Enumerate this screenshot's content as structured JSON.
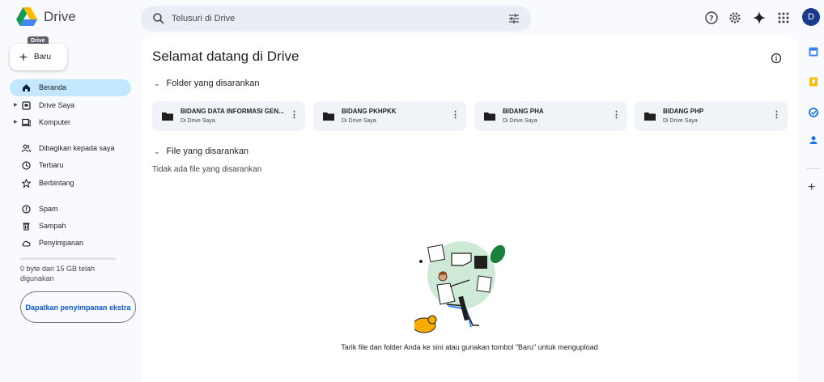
{
  "app": {
    "name": "Drive"
  },
  "header": {
    "search_placeholder": "Telusuri di Drive",
    "avatar_initial": "D",
    "icons": [
      "help-icon",
      "settings-icon",
      "gemini-icon",
      "apps-grid-icon"
    ]
  },
  "sidebar": {
    "tooltip": "Drive",
    "new_label": "Baru",
    "items": [
      {
        "label": "Beranda",
        "icon": "home-icon",
        "active": true
      },
      {
        "label": "Drive Saya",
        "icon": "my-drive-icon",
        "expandable": true
      },
      {
        "label": "Komputer",
        "icon": "computer-icon",
        "expandable": true
      },
      {
        "label": "Dibagikan kepada saya",
        "icon": "shared-icon"
      },
      {
        "label": "Terbaru",
        "icon": "recent-icon"
      },
      {
        "label": "Berbintang",
        "icon": "star-icon"
      },
      {
        "label": "Spam",
        "icon": "spam-icon"
      },
      {
        "label": "Sampah",
        "icon": "trash-icon"
      },
      {
        "label": "Penyimpanan",
        "icon": "cloud-icon"
      }
    ],
    "storage_text": "0 byte dari 15 GB telah digunakan",
    "storage_used_fraction": 0,
    "get_storage_label": "Dapatkan penyimpanan ekstra"
  },
  "main": {
    "welcome": "Selamat datang di Drive",
    "suggested_folders_title": "Folder yang disarankan",
    "folders": [
      {
        "name": "BIDANG DATA INFORMASI GEN...",
        "location": "Di Drive Saya"
      },
      {
        "name": "BIDANG PKHPKK",
        "location": "Di Drive Saya"
      },
      {
        "name": "BIDANG PHA",
        "location": "Di Drive Saya"
      },
      {
        "name": "BIDANG PHP",
        "location": "Di Drive Saya"
      }
    ],
    "suggested_files_title": "File yang disarankan",
    "no_files_text": "Tidak ada file yang disarankan",
    "empty_text": "Tarik file dan folder Anda ke sini atau gunakan tombol \"Baru\" untuk mengupload"
  },
  "right_rail": {
    "apps": [
      "calendar-icon",
      "keep-icon",
      "tasks-icon",
      "contacts-icon"
    ],
    "add_label": "+"
  },
  "colors": {
    "accent_blue": "#0b57d0",
    "active_nav": "#c2e7ff",
    "surface": "#f8fafd",
    "card": "#f0f4f9"
  }
}
